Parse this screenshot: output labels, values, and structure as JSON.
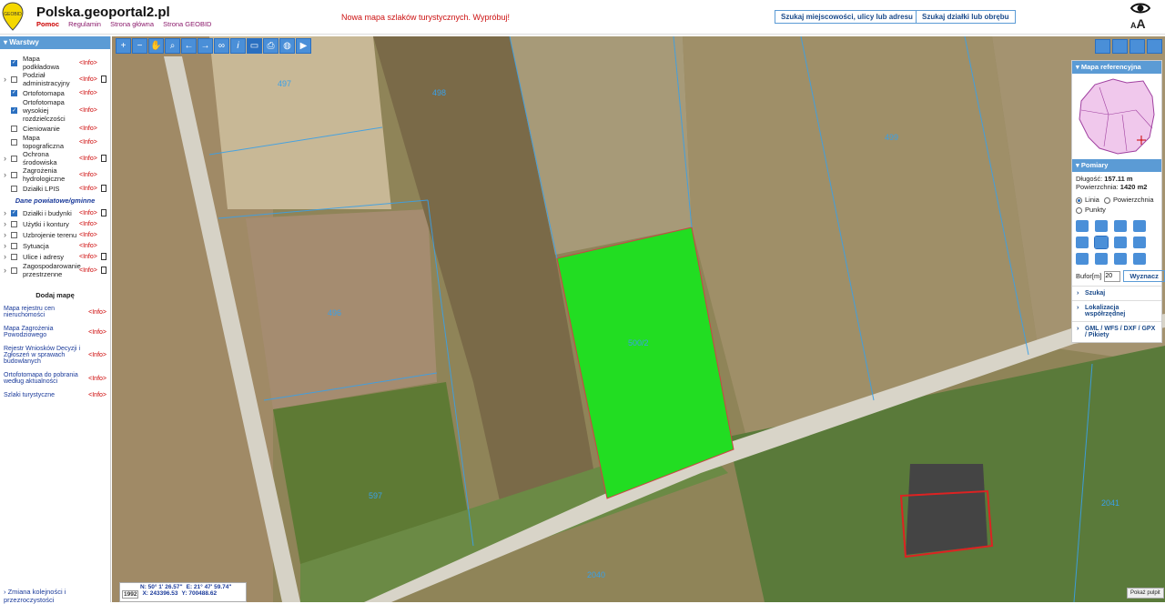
{
  "header": {
    "site_title": "Polska.geoportal2.pl",
    "logo_text": "GEOBID",
    "links": [
      "Pomoc",
      "Regulamin",
      "Strona główna",
      "Strona GEOBID"
    ],
    "promo": "Nowa mapa szlaków turystycznych. Wypróbuj!",
    "search_place_button": "Szukaj miejscowości, ulicy lub adresu",
    "search_plot_button": "Szukaj działki lub obrębu",
    "font_size_label": "A",
    "font_size_small": "A"
  },
  "sidebar": {
    "title": "Warstwy",
    "layers": [
      {
        "label": "Mapa podkładowa",
        "checked": true,
        "expand": false,
        "doc": false
      },
      {
        "label": "Podział administracyjny",
        "checked": false,
        "expand": true,
        "doc": true
      },
      {
        "label": "Ortofotomapa",
        "checked": true,
        "expand": false,
        "doc": false
      },
      {
        "label": "Ortofotomapa wysokiej rozdzielczości",
        "checked": true,
        "expand": false,
        "doc": false
      },
      {
        "label": "Cieniowanie",
        "checked": false,
        "expand": false,
        "doc": false
      },
      {
        "label": "Mapa topograficzna",
        "checked": false,
        "expand": false,
        "doc": false
      },
      {
        "label": "Ochrona środowiska",
        "checked": false,
        "expand": true,
        "doc": true
      },
      {
        "label": "Zagrożenia hydrologiczne",
        "checked": false,
        "expand": true,
        "doc": false
      },
      {
        "label": "Działki LPIS",
        "checked": false,
        "expand": false,
        "doc": true
      }
    ],
    "section_label": "Dane powiatowe/gminne",
    "local_layers": [
      {
        "label": "Działki i budynki",
        "checked": true,
        "expand": true,
        "doc": true
      },
      {
        "label": "Użytki i kontury",
        "checked": false,
        "expand": true,
        "doc": false
      },
      {
        "label": "Uzbrojenie terenu",
        "checked": false,
        "expand": true,
        "doc": false
      },
      {
        "label": "Sytuacja",
        "checked": false,
        "expand": true,
        "doc": false
      },
      {
        "label": "Ulice i adresy",
        "checked": false,
        "expand": true,
        "doc": true
      },
      {
        "label": "Zagospodarowanie przestrzenne",
        "checked": false,
        "expand": true,
        "doc": true
      }
    ],
    "info_label": "<Info>",
    "add_map_title": "Dodaj mapę",
    "add_maps": [
      "Mapa rejestru cen nieruchomości",
      "Mapa Zagrożenia Powodziowego",
      "Rejestr Wniosków Decyzji i Zgłoszeń w sprawach budowlanych",
      "Ortofotomapa do pobrania według aktualności",
      "Szlaki turystyczne"
    ],
    "bottom_link": "Zmiana kolejności i przezroczystości"
  },
  "toolbar": {
    "icons": [
      "zoom-in-icon",
      "zoom-out-icon",
      "pan-hand-icon",
      "zoom-box-icon",
      "back-arrow-icon",
      "forward-arrow-icon",
      "link-icon",
      "info-icon",
      "measure-icon",
      "print-icon",
      "globe-icon",
      "video-icon"
    ]
  },
  "right_panel": {
    "ref_map_title": "Mapa referencyjna",
    "measure_title": "Pomiary",
    "length_label": "Długość:",
    "length_value": "157.11 m",
    "area_label": "Powierzchnia:",
    "area_value": "1420 m2",
    "mode_line": "Linia",
    "mode_area": "Powierzchnia",
    "mode_points": "Punkty",
    "buffer_label": "Bufor[m]",
    "buffer_value": "20",
    "compute_button": "Wyznacz",
    "links": [
      "Szukaj",
      "Lokalizacja współrzędnej",
      "GML / WFS / DXF / GPX / Pikiety"
    ]
  },
  "map": {
    "parcel_labels": [
      "497",
      "498",
      "499",
      "500/2",
      "597",
      "2040",
      "2041",
      "496"
    ],
    "highlight_color": "#22dd22"
  },
  "coords": {
    "crs": "1992",
    "n": "N: 50° 1' 26.57\"",
    "e": "E: 21° 47' 59.74\"",
    "x": "X: 243396.53",
    "y": "Y: 700488.62"
  },
  "show_desktop": "Pokaż pulpit"
}
